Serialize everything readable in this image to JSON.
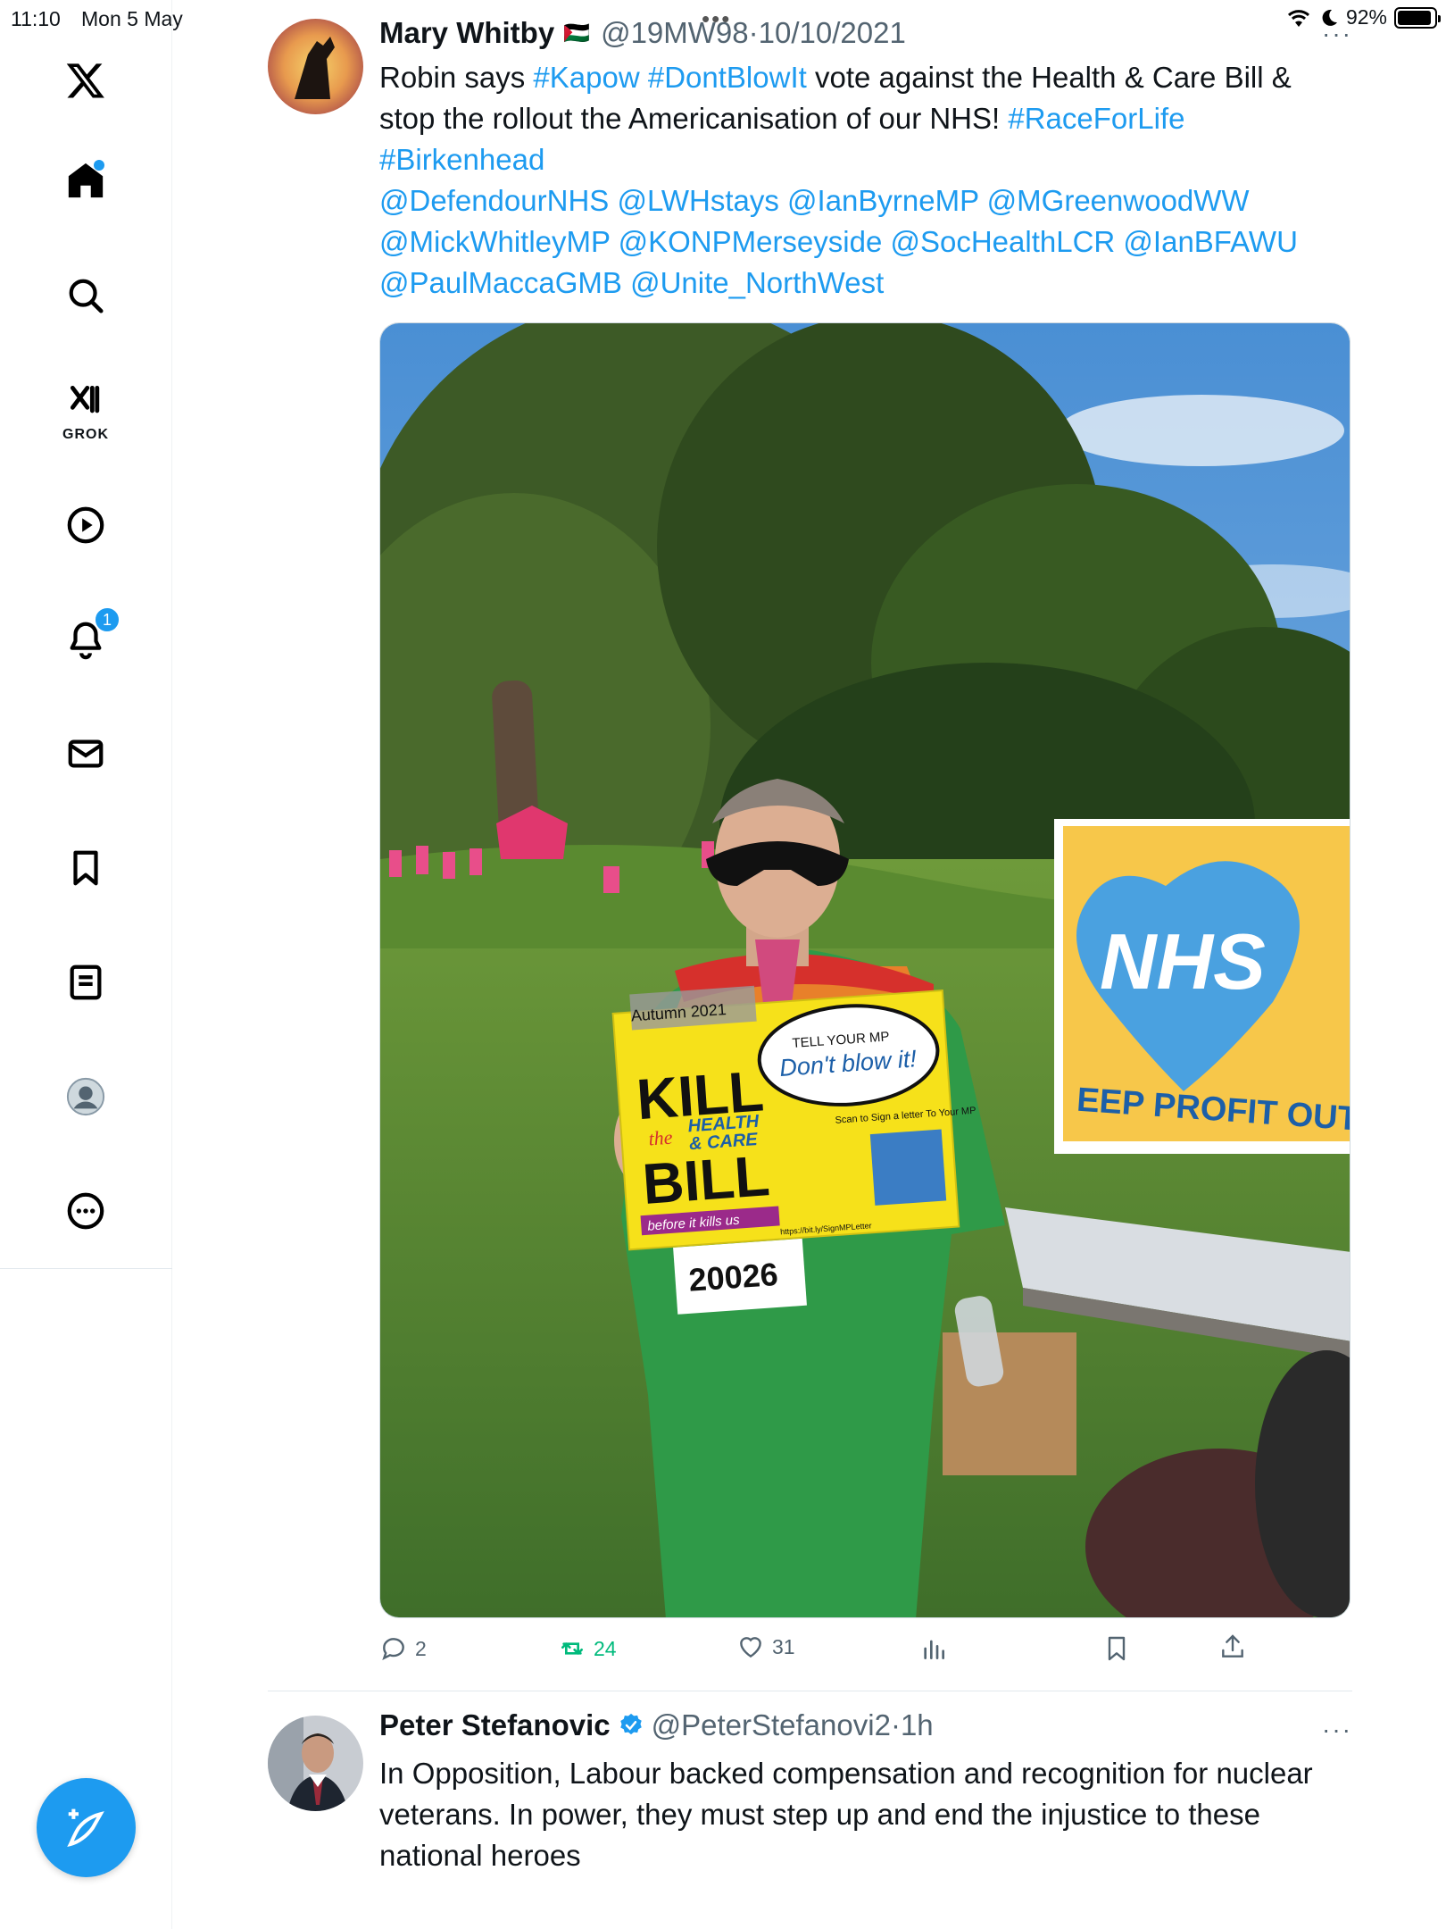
{
  "status_bar": {
    "time": "11:10",
    "date": "Mon 5 May",
    "battery": "92%",
    "battery_level": 0.92
  },
  "sidebar": {
    "items": [
      {
        "icon": "x-logo-icon"
      },
      {
        "icon": "home-icon",
        "has_dot": true
      },
      {
        "icon": "search-icon"
      },
      {
        "icon": "grok-icon",
        "label": "GROK"
      },
      {
        "icon": "video-icon"
      },
      {
        "icon": "bell-icon",
        "badge": "1"
      },
      {
        "icon": "mail-icon"
      },
      {
        "icon": "bookmark-icon"
      },
      {
        "icon": "lists-icon"
      },
      {
        "icon": "profile-icon"
      },
      {
        "icon": "more-icon"
      }
    ],
    "compose_icon": "compose-icon"
  },
  "tweet1": {
    "name": "Mary Whitby",
    "flag": "🇵🇸",
    "handle": "@19MW98",
    "separator": "·",
    "date": "10/10/2021",
    "text": {
      "robin_says": "Robin says ",
      "kapow": "#Kapow",
      "space1": " ",
      "dontblowit": "#DontBlowIt",
      "vote": " vote against the Health & Care Bill & stop the rollout the Americanisation  of our NHS! ",
      "raceforlife": "#RaceForLife",
      "birkenhead": "#Birkenhead",
      "mentions_line1": "@DefendourNHS @LWHstays @IanByrneMP @MGreenwoodWW",
      "mentions_line2": "@MickWhitleyMP @KONPMerseyside @SocHealthLCR @IanBFAWU",
      "mentions_line3": "@PaulMaccaGMB @Unite_NorthWest"
    },
    "image": {
      "sign_autumn": "Autumn 2021",
      "sign_tell": "TELL YOUR MP",
      "sign_dont": "Don't blow it!",
      "sign_kill": "KILL",
      "sign_the": "the",
      "sign_health": "HEALTH",
      "sign_care": "& CARE",
      "sign_bill": "BILL",
      "sign_before": "before it kills us",
      "sign_scan": "Scan to Sign a letter To Your MP",
      "sign_url": "https://bit.ly/SignMPLetter",
      "bib": "20026",
      "banner_nhs": "NHS",
      "banner_profit": "EEP PROFIT OUT"
    },
    "actions": {
      "replies": "2",
      "reposts": "24",
      "likes": "31"
    }
  },
  "tweet2": {
    "name": "Peter Stefanovic",
    "handle": "@PeterStefanovi2",
    "separator": "·",
    "time": "1h",
    "text": "In Opposition, Labour backed compensation and recognition for nuclear veterans. In power, they must step up and end the injustice to these national heroes"
  }
}
